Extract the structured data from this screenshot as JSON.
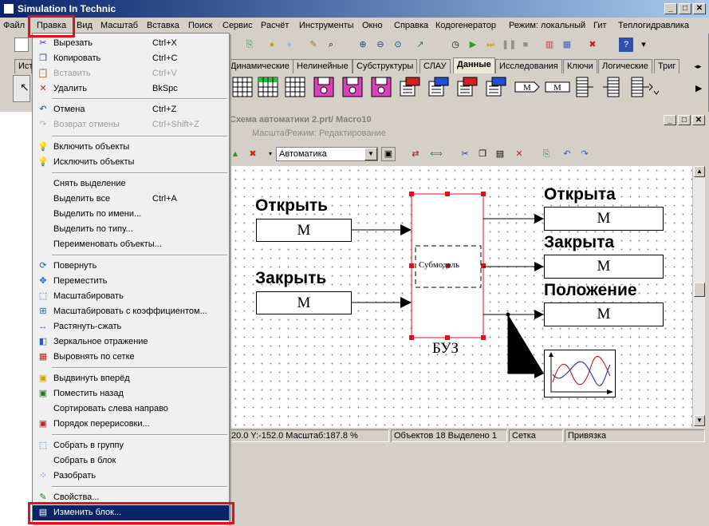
{
  "app": {
    "title": "Simulation In Technic"
  },
  "menubar": [
    "Файл",
    "Правка",
    "Вид",
    "Масштаб",
    "Вставка",
    "Поиск",
    "Сервис",
    "Расчёт",
    "Инструменты",
    "Окно",
    "Справка",
    "Кодогенератор",
    "Режим: локальный",
    "Гит",
    "Теплогидравлика"
  ],
  "library_tabs": [
    "Ист",
    "Динамические",
    "Нелинейные",
    "Субструктуры",
    "СЛАУ",
    "Данные",
    "Исследования",
    "Ключи",
    "Логические",
    "Триг"
  ],
  "active_library_tab": "Данные",
  "dropdown": {
    "items": [
      {
        "label": "Вырезать",
        "shortcut": "Ctrl+X",
        "icon": "scissors-icon",
        "glyph": "✂"
      },
      {
        "label": "Копировать",
        "shortcut": "Ctrl+C",
        "icon": "copy-icon",
        "glyph": "❐"
      },
      {
        "label": "Вставить",
        "shortcut": "Ctrl+V",
        "icon": "paste-icon",
        "glyph": "📋",
        "disabled": true
      },
      {
        "label": "Удалить",
        "shortcut": "BkSpc",
        "icon": "delete-icon",
        "glyph": "✕"
      },
      {
        "label": "Отмена",
        "shortcut": "Ctrl+Z",
        "icon": "undo-icon",
        "glyph": "↶"
      },
      {
        "label": "Возврат отмены",
        "shortcut": "Ctrl+Shift+Z",
        "icon": "redo-icon",
        "glyph": "↷",
        "disabled": true
      },
      {
        "label": "Включить объекты",
        "shortcut": "",
        "icon": "bulb-on-icon",
        "glyph": "💡"
      },
      {
        "label": "Исключить объекты",
        "shortcut": "",
        "icon": "bulb-off-icon",
        "glyph": "💡"
      },
      {
        "label": "Снять выделение",
        "shortcut": "",
        "icon": "",
        "glyph": ""
      },
      {
        "label": "Выделить все",
        "shortcut": "Ctrl+A",
        "icon": "",
        "glyph": ""
      },
      {
        "label": "Выделить по имени...",
        "shortcut": "",
        "icon": "",
        "glyph": ""
      },
      {
        "label": "Выделить по типу...",
        "shortcut": "",
        "icon": "",
        "glyph": ""
      },
      {
        "label": "Переименовать объекты...",
        "shortcut": "",
        "icon": "",
        "glyph": ""
      },
      {
        "label": "Повернуть",
        "shortcut": "",
        "icon": "rotate-icon",
        "glyph": "⟳"
      },
      {
        "label": "Переместить",
        "shortcut": "",
        "icon": "move-icon",
        "glyph": "✥"
      },
      {
        "label": "Масштабировать",
        "shortcut": "",
        "icon": "scale-icon",
        "glyph": "⬚"
      },
      {
        "label": "Масштабировать с коэффициентом...",
        "shortcut": "",
        "icon": "scale-factor-icon",
        "glyph": "⊞"
      },
      {
        "label": "Растянуть-сжать",
        "shortcut": "",
        "icon": "stretch-icon",
        "glyph": "↔"
      },
      {
        "label": "Зеркальное отражение",
        "shortcut": "",
        "icon": "mirror-icon",
        "glyph": "◧"
      },
      {
        "label": "Выровнять по сетке",
        "shortcut": "",
        "icon": "grid-align-icon",
        "glyph": "▦"
      },
      {
        "label": "Выдвинуть вперёд",
        "shortcut": "",
        "icon": "bring-front-icon",
        "glyph": "▣"
      },
      {
        "label": "Поместить назад",
        "shortcut": "",
        "icon": "send-back-icon",
        "glyph": "▣"
      },
      {
        "label": "Сортировать слева направо",
        "shortcut": "",
        "icon": "",
        "glyph": ""
      },
      {
        "label": "Порядок перерисовки...",
        "shortcut": "",
        "icon": "redraw-order-icon",
        "glyph": "▣"
      },
      {
        "label": "Собрать в группу",
        "shortcut": "",
        "icon": "group-icon",
        "glyph": "⬚"
      },
      {
        "label": "Собрать в блок",
        "shortcut": "",
        "icon": "",
        "glyph": ""
      },
      {
        "label": "Разобрать",
        "shortcut": "",
        "icon": "ungroup-icon",
        "glyph": "⁘"
      },
      {
        "label": "Свойства...",
        "shortcut": "",
        "icon": "properties-icon",
        "glyph": "✎"
      },
      {
        "label": "Изменить блок...",
        "shortcut": "",
        "icon": "edit-block-icon",
        "glyph": "▤",
        "highlighted": true
      }
    ]
  },
  "child_window": {
    "title": "Схема автоматики 2.prt/ Macro10",
    "menu": [
      "Масштаб",
      "Режим: Редактирование"
    ],
    "toolbar_select": "Автоматика"
  },
  "diagram": {
    "inputs": [
      {
        "label": "Открыть",
        "block": "M"
      },
      {
        "label": "Закрыть",
        "block": "M"
      }
    ],
    "outputs": [
      {
        "label": "Открыта",
        "block": "M"
      },
      {
        "label": "Закрыта",
        "block": "M"
      },
      {
        "label": "Положение",
        "block": "M"
      }
    ],
    "submodel_text": "Субмодель",
    "main_block_label": "БУЗ"
  },
  "statusbar": {
    "coords": "20.0  Y:-152.0  Масштаб:187.8 %",
    "objects": "Объектов 18  Выделено 1",
    "grid": "Сетка",
    "snap": "Привязка"
  },
  "colors": {
    "highlight": "#0a246a",
    "callout": "#e0101c",
    "selection": "#e0101c"
  }
}
